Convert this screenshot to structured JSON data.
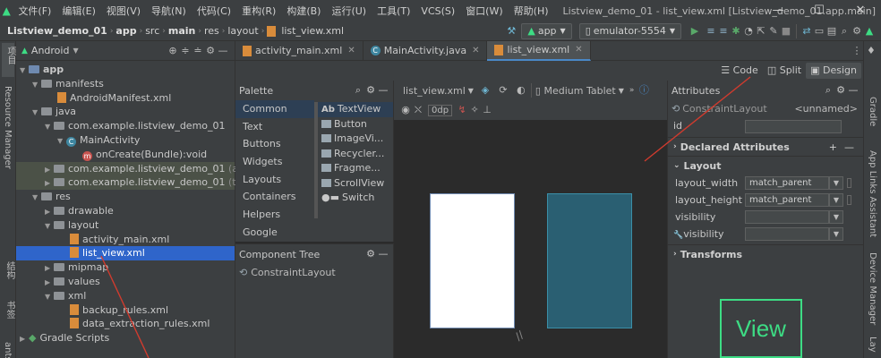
{
  "menu": {
    "items": [
      "文件(F)",
      "编辑(E)",
      "视图(V)",
      "导航(N)",
      "代码(C)",
      "重构(R)",
      "构建(B)",
      "运行(U)",
      "工具(T)",
      "VCS(S)",
      "窗口(W)",
      "帮助(H)"
    ],
    "title": "Listview_demo_01 - list_view.xml [Listview_demo_01.app.main]"
  },
  "breadcrumb": [
    "Listview_demo_01",
    "app",
    "src",
    "main",
    "res",
    "layout",
    "list_view.xml"
  ],
  "toolbar": {
    "config": "app",
    "device": "emulator-5554"
  },
  "left_stripe": {
    "project": "项目",
    "resource_manager": "Resource Manager",
    "structure": "结构",
    "bookmarks": "书签",
    "build_variants": "ants"
  },
  "right_stripe": {
    "gradle": "Gradle",
    "app_links": "App Links Assistant",
    "device_manager": "Device Manager",
    "layout": "Lay"
  },
  "project": {
    "view": "Android",
    "tree": [
      {
        "label": "app",
        "bold": true
      },
      {
        "label": "manifests"
      },
      {
        "label": "AndroidManifest.xml"
      },
      {
        "label": "java"
      },
      {
        "label": "com.example.listview_demo_01"
      },
      {
        "label": "MainActivity"
      },
      {
        "label": "onCreate(Bundle):void"
      },
      {
        "label": "com.example.listview_demo_01",
        "suffix": "(android"
      },
      {
        "label": "com.example.listview_demo_01",
        "suffix": "(test)"
      },
      {
        "label": "res"
      },
      {
        "label": "drawable"
      },
      {
        "label": "layout"
      },
      {
        "label": "activity_main.xml"
      },
      {
        "label": "list_view.xml"
      },
      {
        "label": "mipmap"
      },
      {
        "label": "values"
      },
      {
        "label": "xml"
      },
      {
        "label": "backup_rules.xml"
      },
      {
        "label": "data_extraction_rules.xml"
      },
      {
        "label": "Gradle Scripts"
      }
    ]
  },
  "tabs": [
    "activity_main.xml",
    "MainActivity.java",
    "list_view.xml"
  ],
  "modes": {
    "code": "Code",
    "split": "Split",
    "design": "Design"
  },
  "palette": {
    "title": "Palette",
    "categories": [
      "Common",
      "Text",
      "Buttons",
      "Widgets",
      "Layouts",
      "Containers",
      "Helpers",
      "Google"
    ],
    "items": [
      "TextView",
      "Button",
      "ImageVi...",
      "Recycler...",
      "Fragme...",
      "ScrollView",
      "Switch"
    ]
  },
  "component_tree": {
    "title": "Component Tree",
    "root": "ConstraintLayout"
  },
  "design": {
    "file": "list_view.xml",
    "device": "Medium Tablet",
    "margin": "0dp"
  },
  "attributes": {
    "title": "Attributes",
    "class": "ConstraintLayout",
    "name": "<unnamed>",
    "id_label": "id",
    "declared": "Declared Attributes",
    "layout_section": "Layout",
    "rows": [
      {
        "name": "layout_width",
        "value": "match_parent"
      },
      {
        "name": "layout_height",
        "value": "match_parent"
      },
      {
        "name": "visibility",
        "value": ""
      },
      {
        "name": "visibility",
        "value": ""
      }
    ],
    "transforms": "Transforms",
    "preview": "View"
  },
  "colors": {
    "accent": "#2f65ca",
    "blueprint": "#2a5f72",
    "annotation": "#d13b2e"
  }
}
